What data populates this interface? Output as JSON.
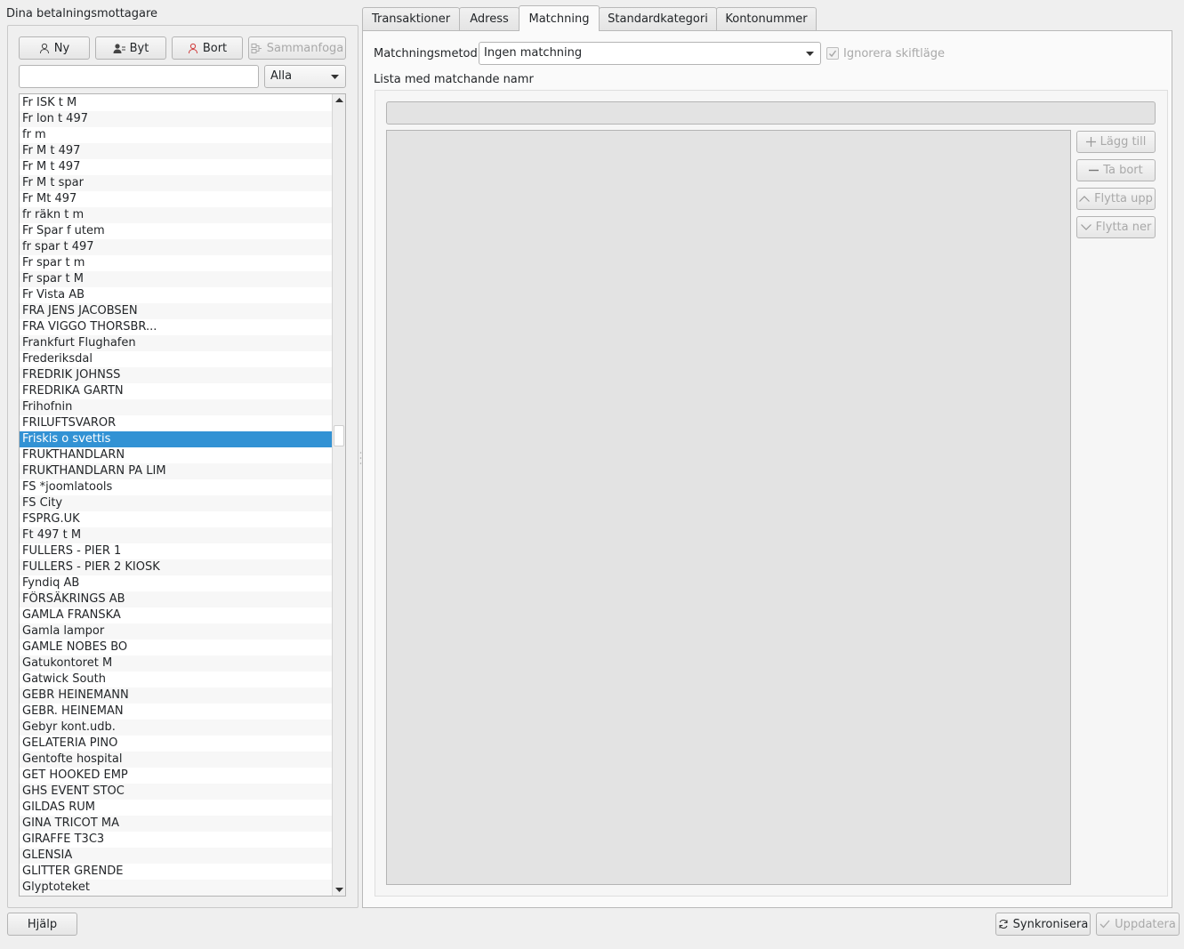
{
  "left_panel": {
    "title": "Dina betalningsmottagare",
    "toolbar": {
      "new_label": "Ny",
      "switch_label": "Byt",
      "remove_label": "Bort",
      "merge_label": "Sammanfoga"
    },
    "search": {
      "value": "",
      "placeholder": ""
    },
    "filter": {
      "selected": "Alla"
    },
    "payees": [
      "Fr ISK t M",
      "Fr lon t 497",
      "fr m",
      "Fr M t 497",
      "Fr M t 497",
      "Fr M t spar",
      "Fr Mt 497",
      "fr räkn t m",
      "Fr Spar f utem",
      "fr spar t 497",
      "Fr spar t m",
      "Fr spar t M",
      "Fr Vista AB",
      "FRA JENS JACOBSEN",
      "FRA VIGGO THORSBR...",
      "Frankfurt Flughafen",
      "Frederiksdal",
      "FREDRIK JOHNSS",
      "FREDRIKA GARTN",
      "Frihofnin",
      "FRILUFTSVAROR",
      "Friskis o svettis",
      "FRUKTHANDLARN",
      "FRUKTHANDLARN PA LIM",
      "FS *joomlatools",
      "FS City",
      "FSPRG.UK",
      "Ft 497 t M",
      "FULLERS - PIER 1",
      "FULLERS - PIER 2 KIOSK",
      "Fyndiq AB",
      "FÖRSÄKRINGS AB",
      "GAMLA FRANSKA",
      "Gamla lampor",
      "GAMLE NOBES BO",
      "Gatukontoret M",
      "Gatwick South",
      "GEBR HEINEMANN",
      "GEBR. HEINEMAN",
      "Gebyr kont.udb.",
      "GELATERIA PINO",
      "Gentofte hospital",
      "GET HOOKED EMP",
      "GHS EVENT STOC",
      "GILDAS RUM",
      "GINA TRICOT MA",
      "GIRAFFE T3C3",
      "GLENSIA",
      "GLITTER GRENDE",
      "Glyptoteket"
    ],
    "selected_payee": "Friskis o svettis"
  },
  "tabs": [
    "Transaktioner",
    "Adress",
    "Matchning",
    "Standardkategori",
    "Kontonummer"
  ],
  "active_tab": "Matchning",
  "matching": {
    "method_label": "Matchningsmetod",
    "method_value": "Ingen matchning",
    "ignore_case_label": "Ignorera skiftläge",
    "list_label": "Lista med matchande namr",
    "add_label": "Lägg till",
    "remove_label": "Ta bort",
    "move_up_label": "Flytta upp",
    "move_down_label": "Flytta ner"
  },
  "footer": {
    "help_label": "Hjälp",
    "sync_label": "Synkronisera",
    "update_label": "Uppdatera"
  }
}
